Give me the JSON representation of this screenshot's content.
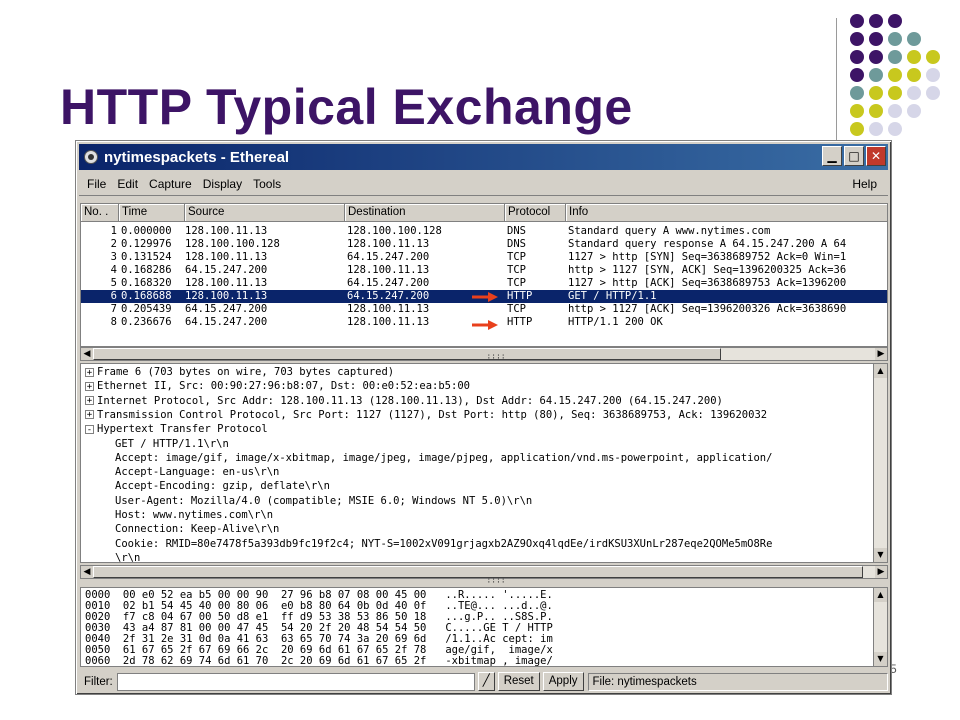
{
  "slide": {
    "title": "HTTP Typical Exchange",
    "page_number": "5",
    "dot_colors": {
      "purple": "#3d1466",
      "teal": "#6e9a9a",
      "lime": "#c8c81e",
      "lavender": "#d6d6e8"
    }
  },
  "window": {
    "title": "nytimespackets - Ethereal",
    "title_icon": "ethereal-icon",
    "buttons": [
      "minimize",
      "maximize",
      "close"
    ]
  },
  "menubar": {
    "items": [
      "File",
      "Edit",
      "Capture",
      "Display",
      "Tools"
    ],
    "help": "Help"
  },
  "packet_list": {
    "columns": [
      "No. .",
      "Time",
      "Source",
      "Destination",
      "Protocol",
      "Info"
    ],
    "rows": [
      {
        "no": "1",
        "time": "0.000000",
        "src": "128.100.11.13",
        "dst": "128.100.100.128",
        "proto": "DNS",
        "info": "Standard query A www.nytimes.com",
        "selected": false
      },
      {
        "no": "2",
        "time": "0.129976",
        "src": "128.100.100.128",
        "dst": "128.100.11.13",
        "proto": "DNS",
        "info": "Standard query response A 64.15.247.200 A 64",
        "selected": false
      },
      {
        "no": "3",
        "time": "0.131524",
        "src": "128.100.11.13",
        "dst": "64.15.247.200",
        "proto": "TCP",
        "info": "1127 > http [SYN] Seq=3638689752 Ack=0 Win=1",
        "selected": false
      },
      {
        "no": "4",
        "time": "0.168286",
        "src": "64.15.247.200",
        "dst": "128.100.11.13",
        "proto": "TCP",
        "info": "http > 1127 [SYN, ACK] Seq=1396200325 Ack=36",
        "selected": false
      },
      {
        "no": "5",
        "time": "0.168320",
        "src": "128.100.11.13",
        "dst": "64.15.247.200",
        "proto": "TCP",
        "info": "1127 > http [ACK] Seq=3638689753 Ack=1396200",
        "selected": false
      },
      {
        "no": "6",
        "time": "0.168688",
        "src": "128.100.11.13",
        "dst": "64.15.247.200",
        "proto": "HTTP",
        "info": "GET / HTTP/1.1",
        "selected": true
      },
      {
        "no": "7",
        "time": "0.205439",
        "src": "64.15.247.200",
        "dst": "128.100.11.13",
        "proto": "TCP",
        "info": "http > 1127 [ACK] Seq=1396200326 Ack=3638690",
        "selected": false
      },
      {
        "no": "8",
        "time": "0.236676",
        "src": "64.15.247.200",
        "dst": "128.100.11.13",
        "proto": "HTTP",
        "info": "HTTP/1.1 200 OK",
        "selected": false
      }
    ]
  },
  "splitter_grip": "∶∶∶∶",
  "detail": {
    "lines": [
      {
        "exp": "+",
        "text": "Frame 6 (703 bytes on wire, 703 bytes captured)",
        "indent": 0
      },
      {
        "exp": "+",
        "text": "Ethernet II, Src: 00:90:27:96:b8:07, Dst: 00:e0:52:ea:b5:00",
        "indent": 0
      },
      {
        "exp": "+",
        "text": "Internet Protocol, Src Addr: 128.100.11.13 (128.100.11.13), Dst Addr: 64.15.247.200 (64.15.247.200)",
        "indent": 0
      },
      {
        "exp": "+",
        "text": "Transmission Control Protocol, Src Port: 1127 (1127), Dst Port: http (80), Seq: 3638689753, Ack: 139620032",
        "indent": 0
      },
      {
        "exp": "-",
        "text": "Hypertext Transfer Protocol",
        "indent": 0
      },
      {
        "exp": "",
        "text": "GET / HTTP/1.1\\r\\n",
        "indent": 1
      },
      {
        "exp": "",
        "text": "Accept: image/gif, image/x-xbitmap, image/jpeg, image/pjpeg, application/vnd.ms-powerpoint, application/",
        "indent": 1
      },
      {
        "exp": "",
        "text": "Accept-Language: en-us\\r\\n",
        "indent": 1
      },
      {
        "exp": "",
        "text": "Accept-Encoding: gzip, deflate\\r\\n",
        "indent": 1
      },
      {
        "exp": "",
        "text": "User-Agent: Mozilla/4.0 (compatible; MSIE 6.0; Windows NT 5.0)\\r\\n",
        "indent": 1
      },
      {
        "exp": "",
        "text": "Host: www.nytimes.com\\r\\n",
        "indent": 1
      },
      {
        "exp": "",
        "text": "Connection: Keep-Alive\\r\\n",
        "indent": 1
      },
      {
        "exp": "",
        "text": "Cookie: RMID=80e7478f5a393db9fc19f2c4; NYT-S=1002xV091grjagxb2AZ9Oxq4lqdEe/irdKSU3XUnLr287eqe2QOMe5mO8Re",
        "indent": 1
      },
      {
        "exp": "",
        "text": "\\r\\n",
        "indent": 1
      }
    ]
  },
  "hex": {
    "lines": [
      "0000  00 e0 52 ea b5 00 00 90  27 96 b8 07 08 00 45 00   ..R..... '.....E.",
      "0010  02 b1 54 45 40 00 80 06  e0 b8 80 64 0b 0d 40 0f   ..TE@... ...d..@.",
      "0020  f7 c8 04 67 00 50 d8 e1  ff d9 53 38 53 86 50 18   ...g.P.. ..S8S.P.",
      "0030  43 a4 87 81 00 00 47 45  54 20 2f 20 48 54 54 50   C.....GE T / HTTP",
      "0040  2f 31 2e 31 0d 0a 41 63  63 65 70 74 3a 20 69 6d   /1.1..Ac cept: im",
      "0050  61 67 65 2f 67 69 66 2c  20 69 6d 61 67 65 2f 78   age/gif,  image/x",
      "0060  2d 78 62 69 74 6d 61 70  2c 20 69 6d 61 67 65 2f   -xbitmap , image/"
    ]
  },
  "statusbar": {
    "filter_label": "Filter:",
    "filter_value": "",
    "reset_label": "Reset",
    "apply_label": "Apply",
    "file_text": "File: nytimespackets"
  },
  "annotation_colors": {
    "arrow": "#e8401c"
  }
}
